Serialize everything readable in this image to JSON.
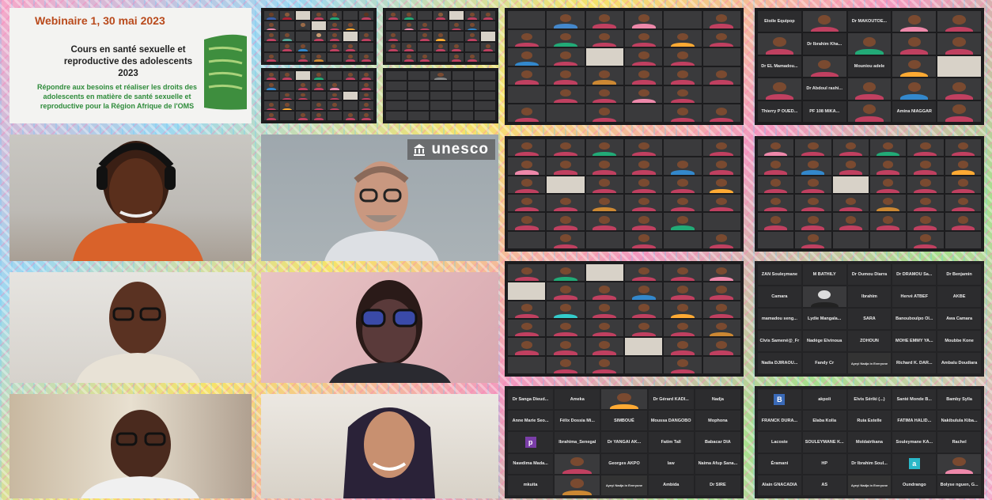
{
  "slide": {
    "title": "Webinaire 1, 30 mai 2023",
    "heading": "Cours en santé sexuelle et reproductive des adolescents 2023",
    "subheading": "Répondre aux besoins et réaliser les droits des adolescents en matière de santé sexuelle et reproductive pour la Région Afrique de l'OMS",
    "footnote": "..."
  },
  "logo": {
    "text": "unesco"
  },
  "colors": {
    "slide_title": "#b94a1c",
    "slide_sub": "#2e8b3a",
    "zoom_bg": "#1c1c1e"
  },
  "names_grid_1": [
    "ZAN Souleymane",
    "M BATHILY",
    "Dr Oumou Diarra",
    "Dr DRAMOU Sa...",
    "Dr Benjamin",
    "Camara",
    "",
    "Ibrahim",
    "Hervé ATBEF",
    "AKBE",
    "mamadou seng...",
    "Lydie Mangala...",
    "SARA",
    "Banouboulpo Ol...",
    "Awa Camara",
    "Clvis Samené@_Fr",
    "Nadège Elvinoua",
    "ZOHOUN",
    "MOHE EMMY YA...",
    "Moubbe Kone",
    "Nadia DJIRAOU...",
    "Fandy Cr",
    "",
    "Richard K. DAR...",
    "Ambalu Doudiara"
  ],
  "names_grid_2": [
    "Dr Sanga Dieud...",
    "Ameka",
    "",
    "Dr Gérard KADI...",
    "Nadja",
    "Anne Marie Seo...",
    "Félix Dossia Mi...",
    "SIMBOUÉ",
    "Moussa DANGOBO",
    "Mophona",
    "",
    "Ibrahima_Senegal",
    "Dr YANGAI AK...",
    "Fatim Tall",
    "Babacar DIA",
    "Nawdima Mada...",
    "",
    "Georges AKPO",
    "law",
    "Naima Afup Sana...",
    "mkuita",
    "",
    "Ayeyi Nadja in Everyone",
    "Ambida",
    "Dr SIRE"
  ],
  "names_grid_3": [
    "B",
    "akpoli",
    "Elvis Sériki (...)",
    "Santé Monde B...",
    "Bamby Sylla",
    "FRANCK DURA...",
    "Elaba Kolla",
    "Ruia Estelle",
    "FATIMA HALID...",
    "Nakibulula Kiba...",
    "Lacoste",
    "SOULEYMANE K...",
    "Moldatrikana",
    "Souleymane KA...",
    "Rachel",
    "Éramani",
    "HP",
    "Dr Ibrahim Soul...",
    "a",
    "",
    "Alain GNACADIA",
    "AS",
    "Ayeyi Nadja in Everyone",
    "Oundrango",
    "Bolyse nguen, G..."
  ],
  "names_grid_4": [
    "Etoile Equipop",
    "",
    "Dr MAKOUTOE...",
    "",
    "",
    "",
    "Dr Ibrahim Kha...",
    "",
    "",
    "",
    "Dr EL Mamadou...",
    "",
    "Mouniou adele",
    "",
    "",
    "",
    "Dr Abdoul rashi...",
    "",
    "",
    "",
    "Thierry P OUED...",
    "PF 108 MIKA...",
    "",
    "Amina NIAGGAR",
    ""
  ],
  "overlay": {
    "chat_hint": "Ayeyi Nadja in Everyone"
  }
}
